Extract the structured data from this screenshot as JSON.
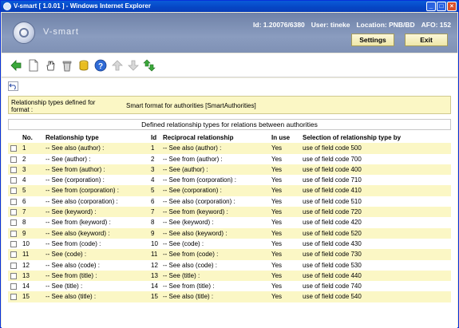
{
  "window": {
    "title": "V-smart [ 1.0.01 ] - Windows Internet Explorer"
  },
  "header": {
    "logo_text": "V-smart",
    "session": {
      "id": "Id: 1.20076/6380",
      "user": "User: tineke",
      "location": "Location: PNB/BD",
      "afo": "AFO: 152"
    },
    "settings_label": "Settings",
    "exit_label": "Exit"
  },
  "toolbar": {
    "icons": [
      "back-arrow-icon",
      "new-document-icon",
      "select-hand-icon",
      "delete-trash-icon",
      "database-icon",
      "help-icon",
      "move-up-icon",
      "move-down-icon",
      "swap-icon"
    ]
  },
  "format": {
    "label": "Relationship types defined for format :",
    "value": "Smart format for authorities [SmartAuthorities]"
  },
  "table": {
    "title": "Defined relationship types for relations between authorities",
    "headers": {
      "no": "No.",
      "type": "Relationship type",
      "id": "Id",
      "recip": "Reciprocal relationship",
      "in_use": "In use",
      "selection": "Selection of relationship type by"
    },
    "rows": [
      {
        "no": "1",
        "type": "-- See also (author) :",
        "id": "1",
        "recip": "-- See also (author) :",
        "in_use": "Yes",
        "selection": "use of field code 500"
      },
      {
        "no": "2",
        "type": "-- See (author) :",
        "id": "2",
        "recip": "-- See from (author) :",
        "in_use": "Yes",
        "selection": "use of field code 700"
      },
      {
        "no": "3",
        "type": "-- See from (author) :",
        "id": "3",
        "recip": "-- See (author) :",
        "in_use": "Yes",
        "selection": "use of field code 400"
      },
      {
        "no": "4",
        "type": "-- See (corporation) :",
        "id": "4",
        "recip": "-- See from (corporation) :",
        "in_use": "Yes",
        "selection": "use of field code 710"
      },
      {
        "no": "5",
        "type": "-- See from (corporation) :",
        "id": "5",
        "recip": "-- See (corporation) :",
        "in_use": "Yes",
        "selection": "use of field code 410"
      },
      {
        "no": "6",
        "type": "-- See also (corporation) :",
        "id": "6",
        "recip": "-- See also (corporation) :",
        "in_use": "Yes",
        "selection": "use of field code 510"
      },
      {
        "no": "7",
        "type": "-- See (keyword) :",
        "id": "7",
        "recip": "-- See from (keyword) :",
        "in_use": "Yes",
        "selection": "use of field code 720"
      },
      {
        "no": "8",
        "type": "-- See from (keyword) :",
        "id": "8",
        "recip": "-- See (keyword) :",
        "in_use": "Yes",
        "selection": "use of field code 420"
      },
      {
        "no": "9",
        "type": "-- See also (keyword) :",
        "id": "9",
        "recip": "-- See also (keyword) :",
        "in_use": "Yes",
        "selection": "use of field code 520"
      },
      {
        "no": "10",
        "type": "-- See from (code) :",
        "id": "10",
        "recip": "-- See (code) :",
        "in_use": "Yes",
        "selection": "use of field code 430"
      },
      {
        "no": "11",
        "type": "-- See (code) :",
        "id": "11",
        "recip": "-- See from (code) :",
        "in_use": "Yes",
        "selection": "use of field code 730"
      },
      {
        "no": "12",
        "type": "-- See also (code) :",
        "id": "12",
        "recip": "-- See also (code) :",
        "in_use": "Yes",
        "selection": "use of field code 530"
      },
      {
        "no": "13",
        "type": "-- See from (title) :",
        "id": "13",
        "recip": "-- See (title) :",
        "in_use": "Yes",
        "selection": "use of field code 440"
      },
      {
        "no": "14",
        "type": "-- See (title) :",
        "id": "14",
        "recip": "-- See from (title) :",
        "in_use": "Yes",
        "selection": "use of field code 740"
      },
      {
        "no": "15",
        "type": "-- See also (title) :",
        "id": "15",
        "recip": "-- See also (title) :",
        "in_use": "Yes",
        "selection": "use of field code 540"
      }
    ]
  }
}
